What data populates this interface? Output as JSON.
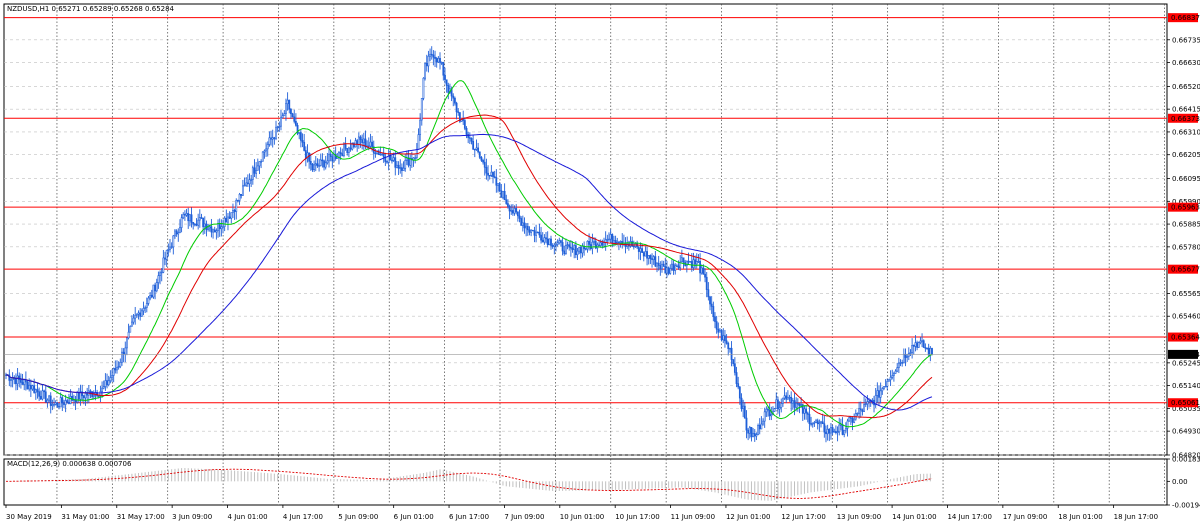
{
  "header": {
    "price_title": "NZDUSD,H1  0.65271 0.65289 0.65268 0.65284",
    "macd_title": "MACD(12,26,9) 0.000638 0.000706"
  },
  "colors": {
    "background": "#ffffff",
    "grid": "#c0c0c0",
    "candle": "#1f5fd8",
    "ma_fast": "#00cc00",
    "ma_mid": "#e00000",
    "ma_slow": "#1a1ad8",
    "level_line": "#ff0000",
    "level_label_bg": "#ff0000",
    "current_price_bg": "#000000",
    "macd_hist": "#c0c0c0",
    "macd_signal": "#e00000"
  },
  "chart_data": [
    {
      "type": "candlestick",
      "symbol": "NZDUSD",
      "timeframe": "H1",
      "title": "NZDUSD,H1  0.65271 0.65289 0.65268 0.65284",
      "ohlc_last": {
        "open": 0.65271,
        "high": 0.65289,
        "low": 0.65268,
        "close": 0.65284
      },
      "ylim": [
        0.6482,
        0.669
      ],
      "grid": true,
      "y_ticks": [
        "0.66735",
        "0.66630",
        "0.66520",
        "0.66415",
        "0.66310",
        "0.66205",
        "0.66095",
        "0.65990",
        "0.65885",
        "0.65780",
        "0.65565",
        "0.65460",
        "0.65245",
        "0.65140",
        "0.65035",
        "0.64930",
        "0.64820"
      ],
      "x_ticks": [
        "30 May 2019",
        "31 May 01:00",
        "31 May 17:00",
        "3 Jun 09:00",
        "4 Jun 01:00",
        "4 Jun 17:00",
        "5 Jun 09:00",
        "6 Jun 01:00",
        "6 Jun 17:00",
        "7 Jun 09:00",
        "10 Jun 01:00",
        "10 Jun 17:00",
        "11 Jun 09:00",
        "12 Jun 01:00",
        "12 Jun 17:00",
        "13 Jun 09:00",
        "14 Jun 01:00",
        "14 Jun 17:00",
        "17 Jun 09:00",
        "18 Jun 01:00",
        "18 Jun 17:00"
      ],
      "price_path": [
        [
          0,
          0.6519
        ],
        [
          3,
          0.6514
        ],
        [
          6,
          0.6505
        ],
        [
          9,
          0.6509
        ],
        [
          12,
          0.6512
        ],
        [
          14,
          0.6524
        ],
        [
          16,
          0.6545
        ],
        [
          18,
          0.6555
        ],
        [
          20,
          0.6575
        ],
        [
          22,
          0.6592
        ],
        [
          24,
          0.659
        ],
        [
          26,
          0.6586
        ],
        [
          28,
          0.6594
        ],
        [
          30,
          0.6608
        ],
        [
          32,
          0.6622
        ],
        [
          34,
          0.6634
        ],
        [
          35,
          0.6644
        ],
        [
          36,
          0.6632
        ],
        [
          38,
          0.6614
        ],
        [
          40,
          0.6618
        ],
        [
          42,
          0.6623
        ],
        [
          44,
          0.6627
        ],
        [
          45,
          0.6625
        ],
        [
          47,
          0.662
        ],
        [
          49,
          0.6615
        ],
        [
          51,
          0.6621
        ],
        [
          52,
          0.666
        ],
        [
          53,
          0.6668
        ],
        [
          54,
          0.6662
        ],
        [
          55,
          0.665
        ],
        [
          57,
          0.6632
        ],
        [
          59,
          0.6618
        ],
        [
          61,
          0.6606
        ],
        [
          63,
          0.6594
        ],
        [
          65,
          0.6586
        ],
        [
          67,
          0.6582
        ],
        [
          68,
          0.658
        ],
        [
          70,
          0.6576
        ],
        [
          72,
          0.6578
        ],
        [
          74,
          0.6581
        ],
        [
          76,
          0.6582
        ],
        [
          78,
          0.6578
        ],
        [
          80,
          0.6573
        ],
        [
          82,
          0.6567
        ],
        [
          84,
          0.6572
        ],
        [
          86,
          0.657
        ],
        [
          87,
          0.656
        ],
        [
          88,
          0.6542
        ],
        [
          90,
          0.653
        ],
        [
          91,
          0.6512
        ],
        [
          92,
          0.6494
        ],
        [
          93,
          0.649
        ],
        [
          94,
          0.65
        ],
        [
          95,
          0.6503
        ],
        [
          96,
          0.6506
        ],
        [
          97,
          0.651
        ],
        [
          98,
          0.6506
        ],
        [
          100,
          0.6498
        ],
        [
          102,
          0.6493
        ],
        [
          104,
          0.6494
        ],
        [
          106,
          0.6502
        ],
        [
          108,
          0.6508
        ],
        [
          110,
          0.652
        ],
        [
          112,
          0.653
        ],
        [
          113,
          0.6534
        ],
        [
          114,
          0.6532
        ],
        [
          115,
          0.65284
        ]
      ],
      "moving_averages": [
        {
          "color": "#00cc00",
          "length": 5
        },
        {
          "color": "#e00000",
          "length": 10
        },
        {
          "color": "#1a1ad8",
          "length": 20
        }
      ],
      "horizontal_levels": [
        "0.66837",
        "0.66373",
        "0.65963",
        "0.65677",
        "0.65364",
        "0.65061"
      ],
      "current_price": "0.65284"
    },
    {
      "type": "bar",
      "title": "MACD(12,26,9) 0.000638 0.000706",
      "macd": 0.000638,
      "signal": 0.000706,
      "ylim": [
        -0.001942,
        0.001833
      ],
      "y_ticks": [
        "0.001833",
        "0.00",
        "-0.001942"
      ],
      "macd_path": [
        [
          0,
          0.0
        ],
        [
          10,
          0.0002
        ],
        [
          18,
          0.0008
        ],
        [
          22,
          0.0011
        ],
        [
          28,
          0.0009
        ],
        [
          34,
          0.0006
        ],
        [
          40,
          0.0002
        ],
        [
          46,
          0.0001
        ],
        [
          52,
          0.0007
        ],
        [
          54,
          0.001
        ],
        [
          58,
          0.0004
        ],
        [
          62,
          -0.0004
        ],
        [
          68,
          -0.0008
        ],
        [
          76,
          -0.0007
        ],
        [
          84,
          -0.0005
        ],
        [
          88,
          -0.0009
        ],
        [
          92,
          -0.0015
        ],
        [
          95,
          -0.0016
        ],
        [
          100,
          -0.0009
        ],
        [
          106,
          -0.0004
        ],
        [
          110,
          0.0002
        ],
        [
          113,
          0.0006
        ],
        [
          115,
          0.000638
        ]
      ],
      "signal_smoothing": 9
    }
  ]
}
